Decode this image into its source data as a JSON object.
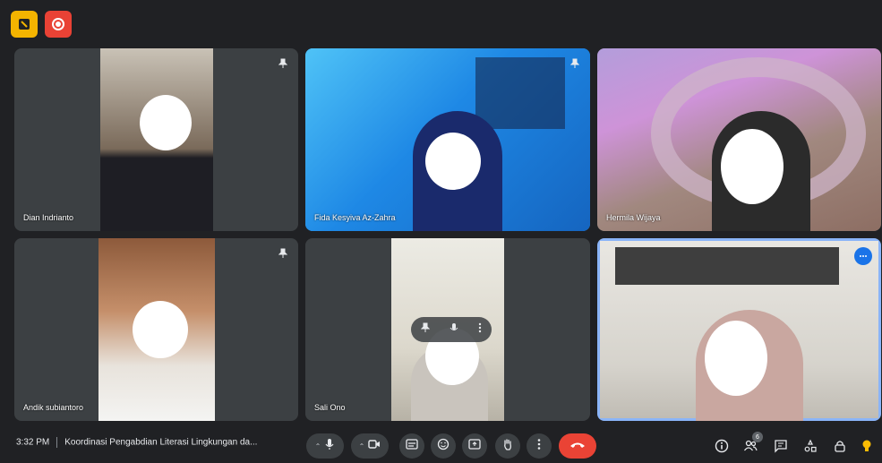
{
  "participants": [
    {
      "name": "Dian Indrianto"
    },
    {
      "name": "Fida Kesyiva Az-Zahra"
    },
    {
      "name": "Hermila Wijaya"
    },
    {
      "name": "Andik subiantoro"
    },
    {
      "name": "Sali Ono"
    },
    {
      "name": ""
    }
  ],
  "meeting": {
    "time": "3:32 PM",
    "title": "Koordinasi Pengabdian Literasi Lingkungan da..."
  },
  "people_count": "6",
  "colors": {
    "background": "#202124",
    "tile": "#3c4043",
    "end_call": "#ea4335",
    "active_border": "#8ab4f8",
    "record": "#e94235",
    "activity": "#f4b400"
  },
  "icons": [
    "activity-icon",
    "record-icon",
    "mic-icon",
    "camera-icon",
    "captions-icon",
    "emoji-icon",
    "present-icon",
    "raise-hand-icon",
    "more-options-icon",
    "end-call-icon",
    "info-icon",
    "people-icon",
    "chat-icon",
    "activities-icon",
    "host-controls-icon",
    "lightbulb-icon"
  ]
}
